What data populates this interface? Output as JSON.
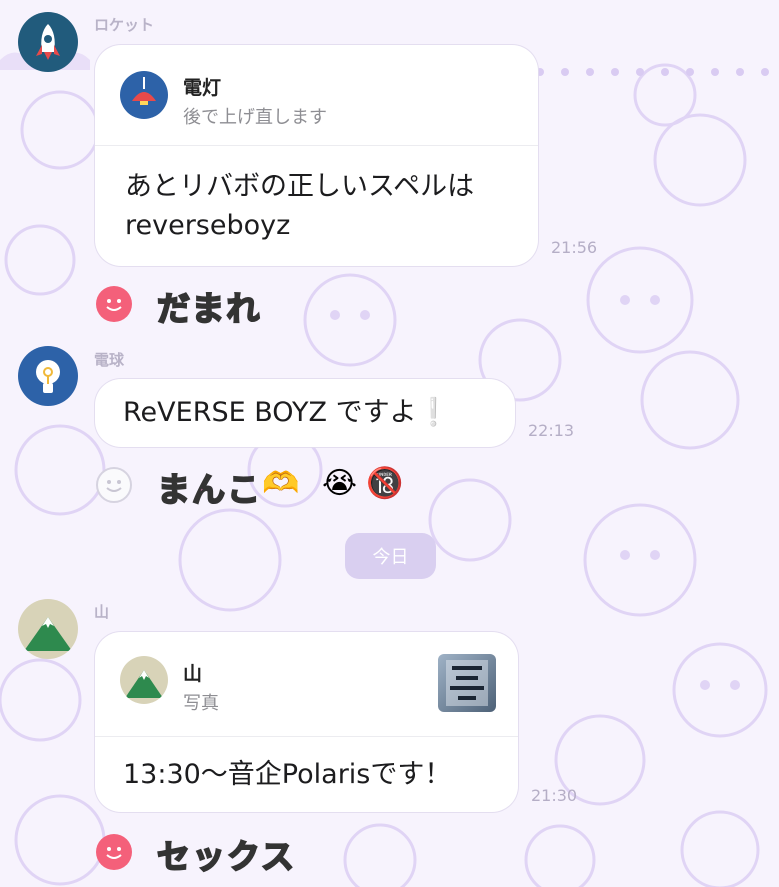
{
  "messages": [
    {
      "sender": "ロケット",
      "avatar_icon": "rocket-icon",
      "reply": {
        "name": "電灯",
        "subtitle": "後で上げ直します",
        "icon": "lamp-icon"
      },
      "text_line1": "あとリバボの正しいスペルは",
      "text_line2": "reverseboyz",
      "time": "21:56",
      "reaction_text": "だまれ"
    },
    {
      "sender": "電球",
      "avatar_icon": "lightbulb-icon",
      "text": "ReVERSE BOYZ ですよ",
      "text_suffix": "❕",
      "time": "22:13",
      "reaction_text": "まんこ",
      "reaction_emojis": [
        "🫶",
        "😭",
        "🔞"
      ]
    },
    {
      "sender": "山",
      "avatar_icon": "mountain-icon",
      "reply": {
        "name": "山",
        "subtitle": "写真",
        "icon": "mountain-icon"
      },
      "text": "13:30～音企Polarisです！",
      "time": "21:30",
      "reaction_text": "セックス"
    }
  ],
  "date_separator": "今日",
  "colors": {
    "background": "#f7f3fd",
    "pattern": "#e3d9f6",
    "pill": "#d9cff0",
    "react_pink": "#f4607a"
  }
}
